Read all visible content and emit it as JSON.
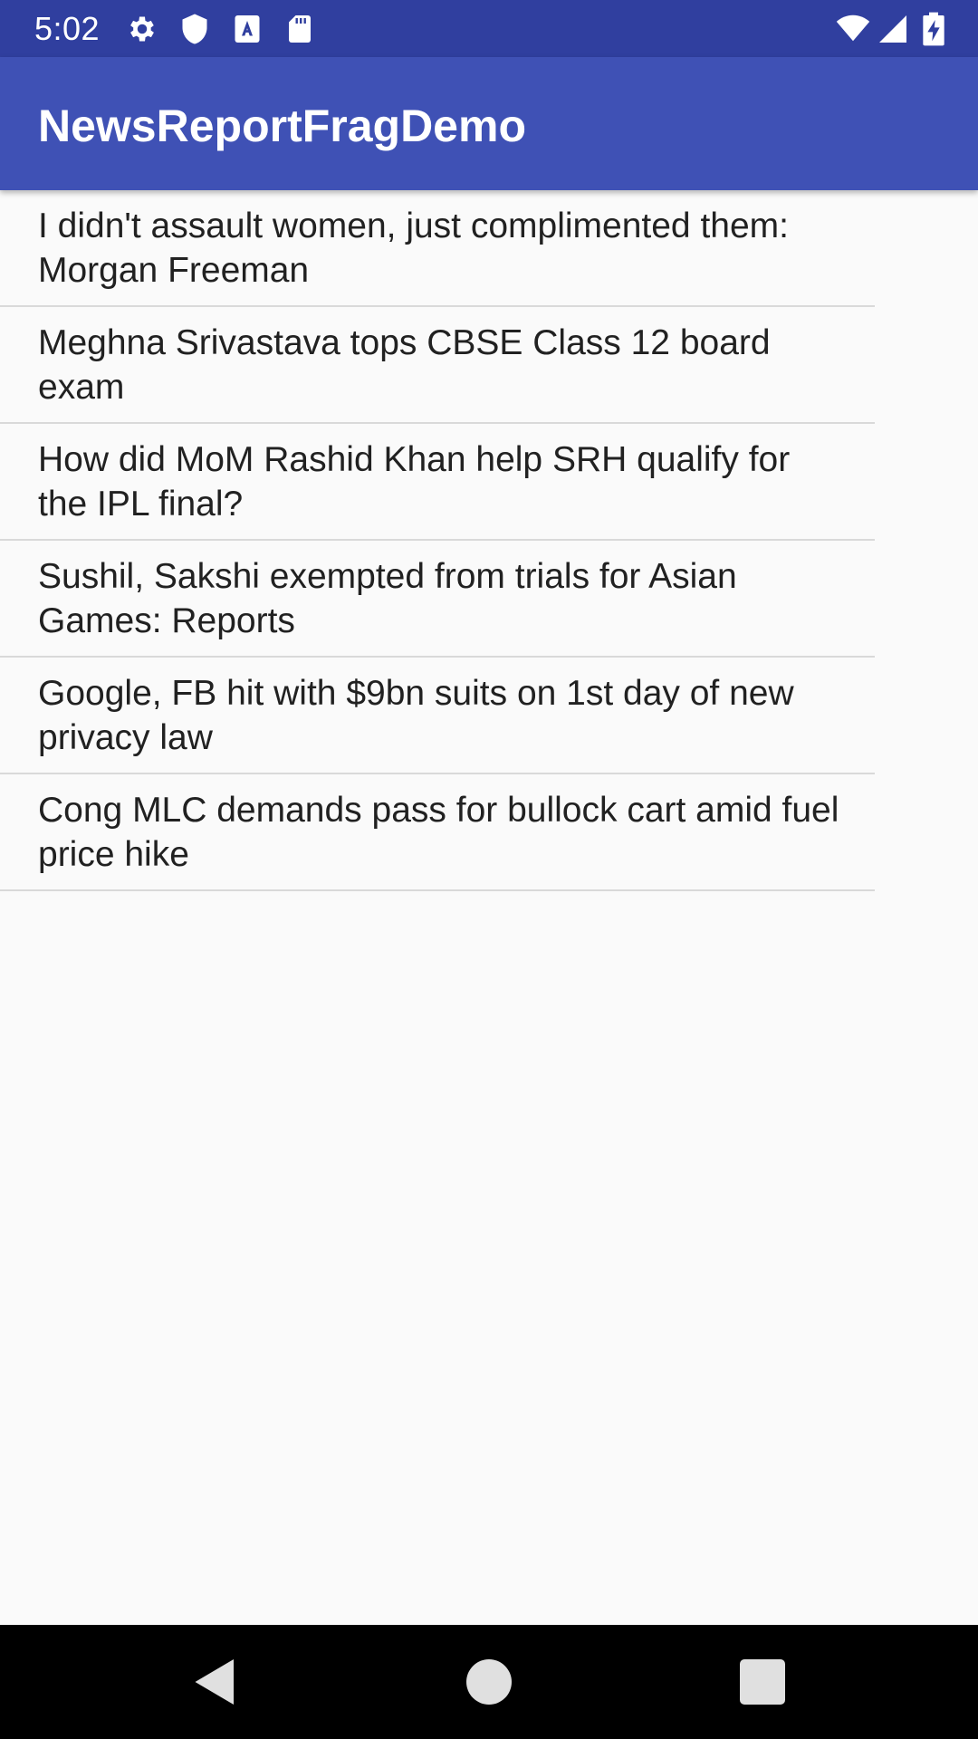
{
  "status_bar": {
    "time": "5:02",
    "left_icons": [
      "gear-icon",
      "shield-icon",
      "font-a-icon",
      "sd-card-icon"
    ],
    "right_icons": [
      "wifi-icon",
      "cell-signal-icon",
      "battery-charging-icon"
    ],
    "color": "#303f9f"
  },
  "app_bar": {
    "title": "NewsReportFragDemo",
    "color": "#3f51b5"
  },
  "news": [
    {
      "headline": "I didn't assault women, just complimented them: Morgan Freeman"
    },
    {
      "headline": "Meghna Srivastava tops CBSE Class 12 board exam"
    },
    {
      "headline": "How did MoM Rashid Khan help SRH qualify for the IPL final?"
    },
    {
      "headline": "Sushil, Sakshi exempted from trials for Asian Games: Reports"
    },
    {
      "headline": "Google, FB hit with $9bn suits on 1st day of new privacy law"
    },
    {
      "headline": "Cong MLC demands pass for bullock cart amid fuel price hike"
    }
  ],
  "nav_bar": {
    "buttons": [
      "back-icon",
      "home-icon",
      "recents-icon"
    ]
  }
}
